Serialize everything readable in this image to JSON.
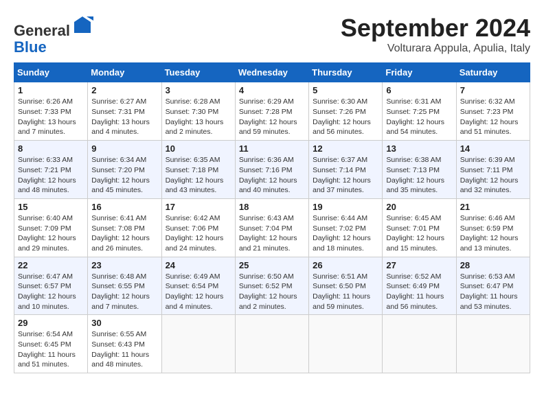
{
  "header": {
    "logo_line1": "General",
    "logo_line2": "Blue",
    "month": "September 2024",
    "location": "Volturara Appula, Apulia, Italy"
  },
  "weekdays": [
    "Sunday",
    "Monday",
    "Tuesday",
    "Wednesday",
    "Thursday",
    "Friday",
    "Saturday"
  ],
  "weeks": [
    [
      {
        "day": "1",
        "info": "Sunrise: 6:26 AM\nSunset: 7:33 PM\nDaylight: 13 hours\nand 7 minutes."
      },
      {
        "day": "2",
        "info": "Sunrise: 6:27 AM\nSunset: 7:31 PM\nDaylight: 13 hours\nand 4 minutes."
      },
      {
        "day": "3",
        "info": "Sunrise: 6:28 AM\nSunset: 7:30 PM\nDaylight: 13 hours\nand 2 minutes."
      },
      {
        "day": "4",
        "info": "Sunrise: 6:29 AM\nSunset: 7:28 PM\nDaylight: 12 hours\nand 59 minutes."
      },
      {
        "day": "5",
        "info": "Sunrise: 6:30 AM\nSunset: 7:26 PM\nDaylight: 12 hours\nand 56 minutes."
      },
      {
        "day": "6",
        "info": "Sunrise: 6:31 AM\nSunset: 7:25 PM\nDaylight: 12 hours\nand 54 minutes."
      },
      {
        "day": "7",
        "info": "Sunrise: 6:32 AM\nSunset: 7:23 PM\nDaylight: 12 hours\nand 51 minutes."
      }
    ],
    [
      {
        "day": "8",
        "info": "Sunrise: 6:33 AM\nSunset: 7:21 PM\nDaylight: 12 hours\nand 48 minutes."
      },
      {
        "day": "9",
        "info": "Sunrise: 6:34 AM\nSunset: 7:20 PM\nDaylight: 12 hours\nand 45 minutes."
      },
      {
        "day": "10",
        "info": "Sunrise: 6:35 AM\nSunset: 7:18 PM\nDaylight: 12 hours\nand 43 minutes."
      },
      {
        "day": "11",
        "info": "Sunrise: 6:36 AM\nSunset: 7:16 PM\nDaylight: 12 hours\nand 40 minutes."
      },
      {
        "day": "12",
        "info": "Sunrise: 6:37 AM\nSunset: 7:14 PM\nDaylight: 12 hours\nand 37 minutes."
      },
      {
        "day": "13",
        "info": "Sunrise: 6:38 AM\nSunset: 7:13 PM\nDaylight: 12 hours\nand 35 minutes."
      },
      {
        "day": "14",
        "info": "Sunrise: 6:39 AM\nSunset: 7:11 PM\nDaylight: 12 hours\nand 32 minutes."
      }
    ],
    [
      {
        "day": "15",
        "info": "Sunrise: 6:40 AM\nSunset: 7:09 PM\nDaylight: 12 hours\nand 29 minutes."
      },
      {
        "day": "16",
        "info": "Sunrise: 6:41 AM\nSunset: 7:08 PM\nDaylight: 12 hours\nand 26 minutes."
      },
      {
        "day": "17",
        "info": "Sunrise: 6:42 AM\nSunset: 7:06 PM\nDaylight: 12 hours\nand 24 minutes."
      },
      {
        "day": "18",
        "info": "Sunrise: 6:43 AM\nSunset: 7:04 PM\nDaylight: 12 hours\nand 21 minutes."
      },
      {
        "day": "19",
        "info": "Sunrise: 6:44 AM\nSunset: 7:02 PM\nDaylight: 12 hours\nand 18 minutes."
      },
      {
        "day": "20",
        "info": "Sunrise: 6:45 AM\nSunset: 7:01 PM\nDaylight: 12 hours\nand 15 minutes."
      },
      {
        "day": "21",
        "info": "Sunrise: 6:46 AM\nSunset: 6:59 PM\nDaylight: 12 hours\nand 13 minutes."
      }
    ],
    [
      {
        "day": "22",
        "info": "Sunrise: 6:47 AM\nSunset: 6:57 PM\nDaylight: 12 hours\nand 10 minutes."
      },
      {
        "day": "23",
        "info": "Sunrise: 6:48 AM\nSunset: 6:55 PM\nDaylight: 12 hours\nand 7 minutes."
      },
      {
        "day": "24",
        "info": "Sunrise: 6:49 AM\nSunset: 6:54 PM\nDaylight: 12 hours\nand 4 minutes."
      },
      {
        "day": "25",
        "info": "Sunrise: 6:50 AM\nSunset: 6:52 PM\nDaylight: 12 hours\nand 2 minutes."
      },
      {
        "day": "26",
        "info": "Sunrise: 6:51 AM\nSunset: 6:50 PM\nDaylight: 11 hours\nand 59 minutes."
      },
      {
        "day": "27",
        "info": "Sunrise: 6:52 AM\nSunset: 6:49 PM\nDaylight: 11 hours\nand 56 minutes."
      },
      {
        "day": "28",
        "info": "Sunrise: 6:53 AM\nSunset: 6:47 PM\nDaylight: 11 hours\nand 53 minutes."
      }
    ],
    [
      {
        "day": "29",
        "info": "Sunrise: 6:54 AM\nSunset: 6:45 PM\nDaylight: 11 hours\nand 51 minutes."
      },
      {
        "day": "30",
        "info": "Sunrise: 6:55 AM\nSunset: 6:43 PM\nDaylight: 11 hours\nand 48 minutes."
      },
      {
        "day": "",
        "info": ""
      },
      {
        "day": "",
        "info": ""
      },
      {
        "day": "",
        "info": ""
      },
      {
        "day": "",
        "info": ""
      },
      {
        "day": "",
        "info": ""
      }
    ]
  ]
}
